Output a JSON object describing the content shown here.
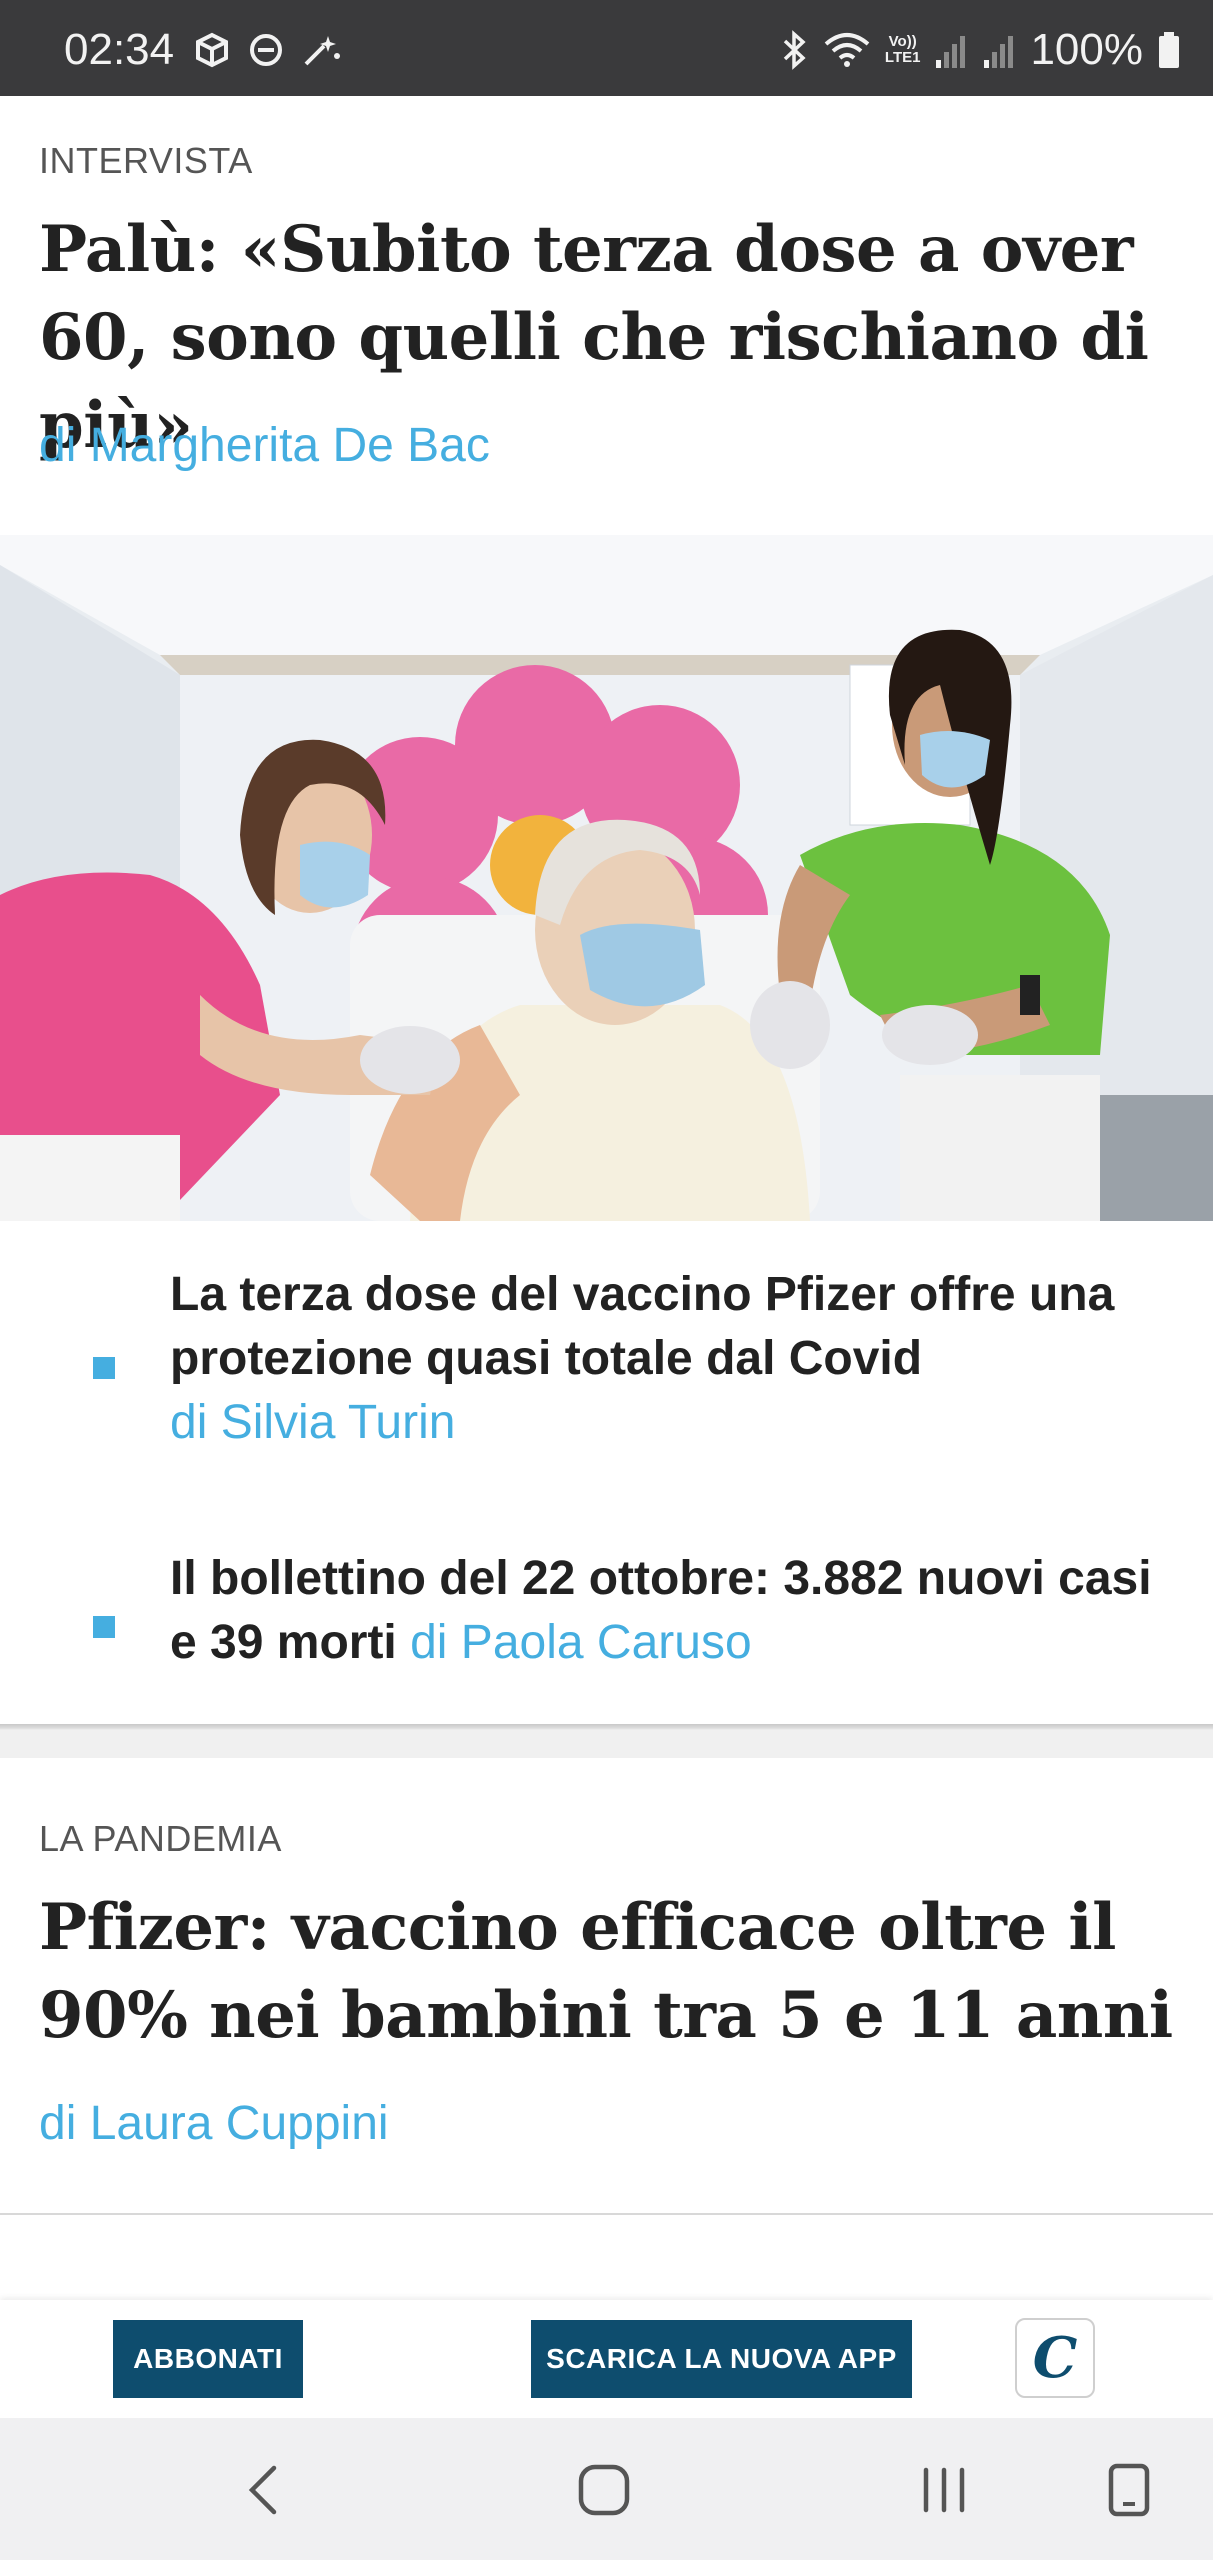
{
  "status_bar": {
    "time": "02:34",
    "battery": "100%",
    "left_icons": [
      "package-icon",
      "do-not-disturb-icon",
      "sparkle-icon"
    ],
    "right_icons": [
      "bluetooth-icon",
      "wifi-icon",
      "volte-icon",
      "signal-icon",
      "signal-icon",
      "battery-icon"
    ],
    "volte_label": "Vo))",
    "lte_label": "LTE1"
  },
  "article1": {
    "section": "INTERVISTA",
    "title": "Palù: «Subito terza dose a over 60, sono quelli che rischiano di più»",
    "author": "di Margherita De Bac",
    "related": [
      {
        "text": "La terza dose del vaccino Pfizer offre una protezione quasi totale dal Covid",
        "author": "di Silvia Turin"
      },
      {
        "text": "Il bollettino del 22 ottobre: 3.882 nuovi casi e 39 morti",
        "author": "di Paola Caruso"
      }
    ]
  },
  "article2": {
    "section": "LA PANDEMIA",
    "title": "Pfizer: vaccino efficace oltre il 90% nei bambini tra 5 e 11 anni",
    "author": "di Laura Cuppini"
  },
  "banner": {
    "subscribe_label": "ABBONATI",
    "download_label": "SCARICA LA NUOVA APP",
    "logo_letter": "C"
  },
  "nav_bar": {
    "icons": [
      "back-icon",
      "home-icon",
      "recents-icon",
      "screenshot-icon"
    ]
  },
  "colors": {
    "accent": "#45aee0",
    "button_bg": "#0e4d6e",
    "status_bar_bg": "#3a3a3c"
  }
}
